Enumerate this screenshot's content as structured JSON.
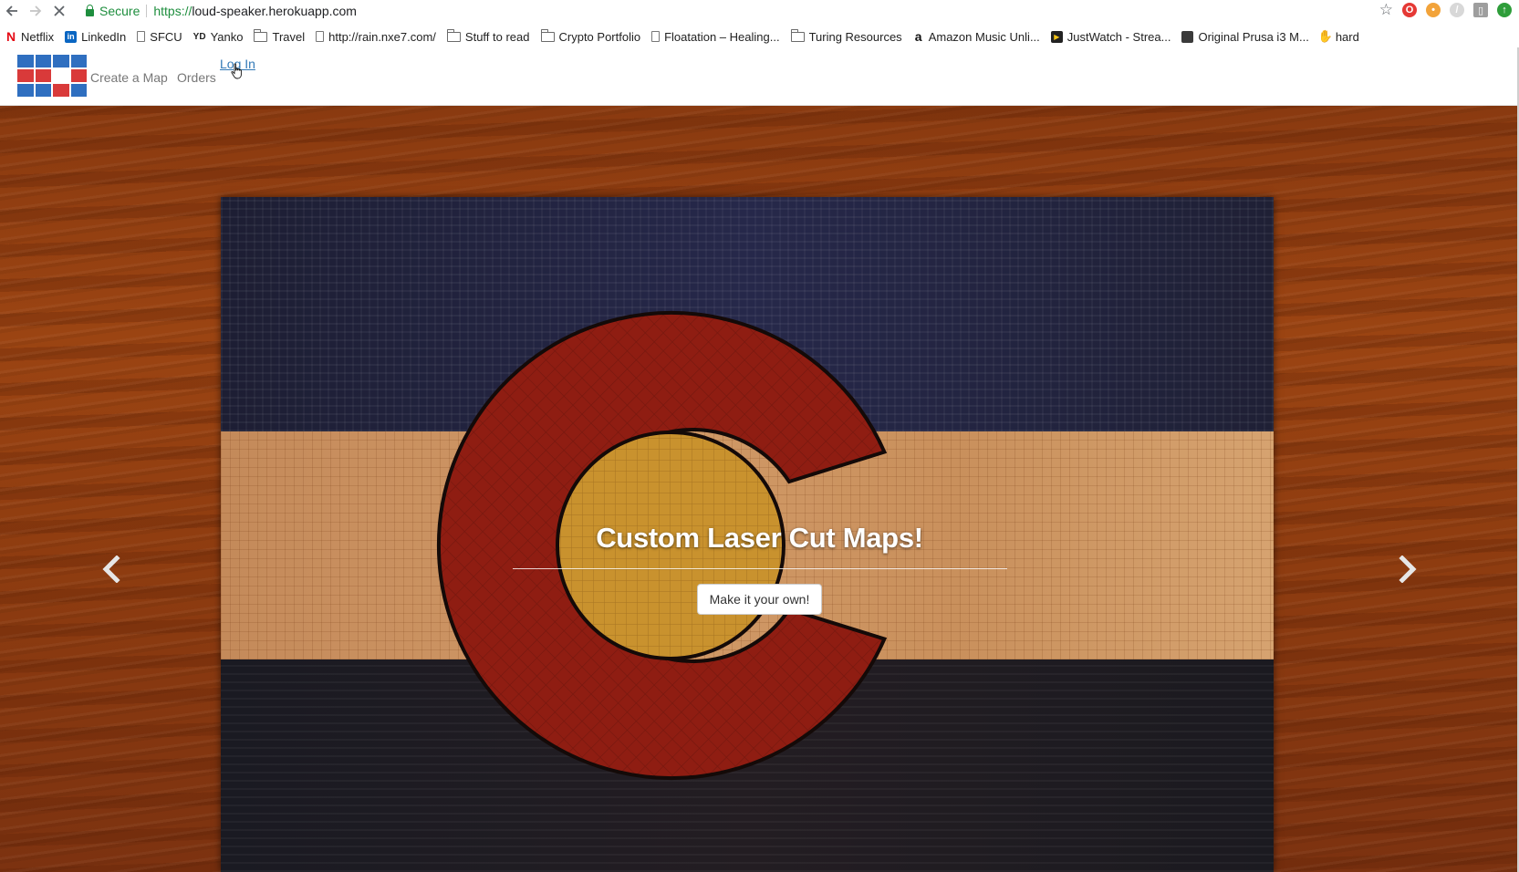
{
  "browser": {
    "secure_label": "Secure",
    "url_scheme": "https://",
    "url_host": "loud-speaker.herokuapp.com",
    "bookmarks": [
      {
        "label": "Netflix",
        "icon": "netflix-icon"
      },
      {
        "label": "LinkedIn",
        "icon": "linkedin-icon"
      },
      {
        "label": "SFCU",
        "icon": "page-icon"
      },
      {
        "label": "Yanko",
        "icon": "yd-icon"
      },
      {
        "label": "Travel",
        "icon": "folder-icon"
      },
      {
        "label": "http://rain.nxe7.com/",
        "icon": "page-icon"
      },
      {
        "label": "Stuff to read",
        "icon": "folder-icon"
      },
      {
        "label": "Crypto Portfolio",
        "icon": "folder-icon"
      },
      {
        "label": "Floatation – Healing...",
        "icon": "page-icon"
      },
      {
        "label": "Turing Resources",
        "icon": "folder-icon"
      },
      {
        "label": "Amazon Music Unli...",
        "icon": "amazon-icon"
      },
      {
        "label": "JustWatch - Strea...",
        "icon": "justwatch-icon"
      },
      {
        "label": "Original Prusa i3 M...",
        "icon": "prusa-icon"
      },
      {
        "label": "hard",
        "icon": "hard-icon"
      }
    ]
  },
  "navbar": {
    "create_label": "Create a Map",
    "orders_label": "Orders",
    "login_label": "Log In",
    "logo_colors": [
      "#2f6fc0",
      "#2f6fc0",
      "#2f6fc0",
      "#2f6fc0",
      "#d93a3a",
      "#d93a3a",
      "#ffffff",
      "#d93a3a",
      "#2f6fc0",
      "#2f6fc0",
      "#d93a3a",
      "#2f6fc0"
    ]
  },
  "hero": {
    "title": "Custom Laser Cut Maps!",
    "button_label": "Make it your own!",
    "flag_colors": {
      "blue": "#1f2035",
      "gold_stripe": "#d19a68",
      "red": "#8f1d12",
      "gold_center": "#c9922e"
    }
  }
}
